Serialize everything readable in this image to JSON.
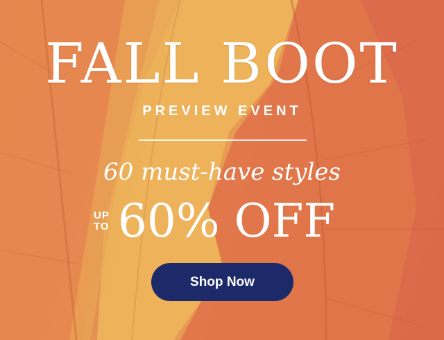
{
  "hero": {
    "headline": "FALL BOOT",
    "subhead": "PREVIEW EVENT",
    "tagline": "60 must-have styles",
    "offer_prefix_line1": "UP",
    "offer_prefix_line2": "TO",
    "offer_amount": "60% OFF",
    "cta_label": "Shop Now"
  },
  "colors": {
    "cta_background": "#1d2a6a",
    "text": "#ffffff",
    "background_orange": "#e2804d",
    "background_yellow": "#e9a457"
  },
  "background": {
    "description_icon": "autumn-leaf-icon"
  }
}
